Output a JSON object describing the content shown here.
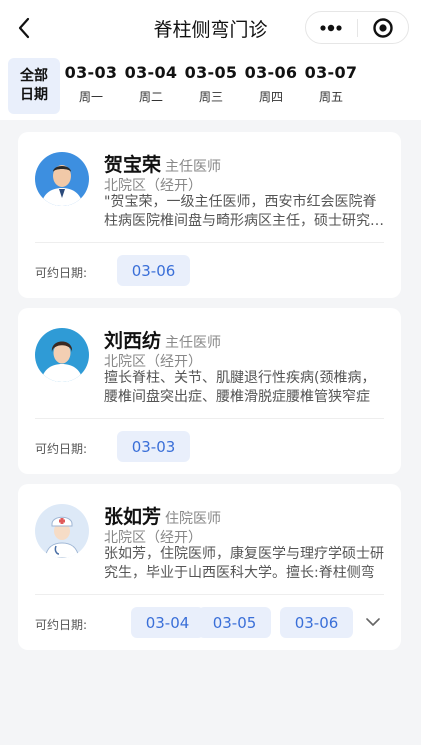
{
  "header": {
    "title": "脊柱侧弯门诊",
    "back_icon": "chevron-left-icon",
    "more_icon": "more-dots-icon",
    "circle_icon": "target-circle-icon"
  },
  "datebar": {
    "all_line1": "全部",
    "all_line2": "日期",
    "dates": [
      {
        "date": "03-03",
        "weekday": "周一"
      },
      {
        "date": "03-04",
        "weekday": "周二"
      },
      {
        "date": "03-05",
        "weekday": "周三"
      },
      {
        "date": "03-06",
        "weekday": "周四"
      },
      {
        "date": "03-07",
        "weekday": "周五"
      }
    ]
  },
  "doctors": [
    {
      "name": "贺宝荣",
      "rank": "主任医师",
      "dept": "北院区（经开）",
      "intro": "\"贺宝荣，一级主任医师，西安市红会医院脊柱病医院椎间盘与畸形病区主任，硕士研究生导师",
      "avail_label": "可约日期:",
      "dates": [
        "03-06"
      ]
    },
    {
      "name": "刘西纺",
      "rank": "主任医师",
      "dept": "北院区（经开）",
      "intro": "擅长脊柱、关节、肌腱退行性疾病(颈椎病，腰椎间盘突出症、腰椎滑脱症腰椎管狭窄症",
      "avail_label": "可约日期:",
      "dates": [
        "03-03"
      ]
    },
    {
      "name": "张如芳",
      "rank": "住院医师",
      "dept": "北院区（经开）",
      "intro": "张如芳，住院医师，康复医学与理疗学硕士研究生，毕业于山西医科大学。擅长:脊柱侧弯",
      "avail_label": "可约日期:",
      "dates": [
        "03-04",
        "03-05",
        "03-06"
      ]
    }
  ],
  "colors": {
    "accent": "#3a6fd8",
    "chip_bg": "#e9effb",
    "page_bg": "#f4f5f7"
  }
}
